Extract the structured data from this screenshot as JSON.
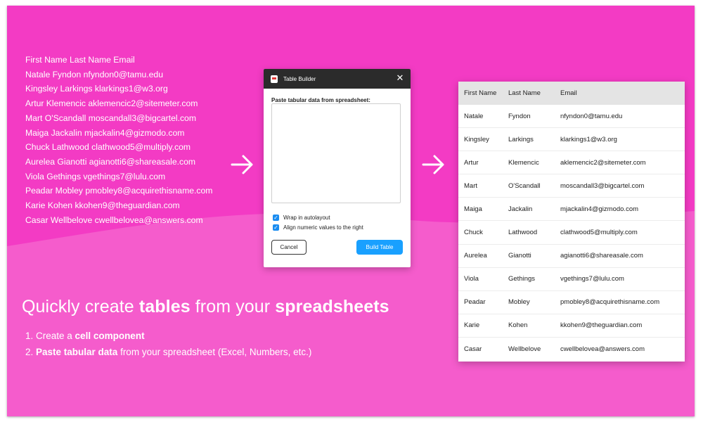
{
  "colors": {
    "background": "#f33bc4",
    "wave": "#f55ccc",
    "accent_button": "#19a0ff",
    "titlebar": "#2b2b2b"
  },
  "plain_text_lines": [
    "First Name Last Name Email",
    "Natale Fyndon nfyndon0@tamu.edu",
    "Kingsley Larkings klarkings1@w3.org",
    "Artur Klemencic aklemencic2@sitemeter.com",
    "Mart O'Scandall moscandall3@bigcartel.com",
    "Maiga Jackalin mjackalin4@gizmodo.com",
    "Chuck Lathwood clathwood5@multiply.com",
    "Aurelea Gianotti agianotti6@shareasale.com",
    "Viola Gethings vgethings7@lulu.com",
    "Peadar Mobley pmobley8@acquirethisname.com",
    "Karie Kohen kkohen9@theguardian.com",
    "Casar Wellbelove cwellbelovea@answers.com"
  ],
  "dialog": {
    "title": "Table Builder",
    "icon": "table-builder-app-icon",
    "close_icon": "close-icon",
    "paste_label": "Paste tabular data from spreadsheet:",
    "paste_value": "",
    "option_wrap": "Wrap in autolayout",
    "option_wrap_checked": true,
    "option_align": "Align numeric values to the right",
    "option_align_checked": true,
    "cancel_label": "Cancel",
    "build_label": "Build Table"
  },
  "arrows": [
    "arrow-right-icon",
    "arrow-right-icon"
  ],
  "heading": {
    "part1": "Quickly create ",
    "bold1": "tables",
    "part2": " from your ",
    "bold2": "spreadsheets"
  },
  "steps": [
    {
      "num": "1. ",
      "plain_before": "Create a ",
      "bold": "cell component",
      "plain_after": ""
    },
    {
      "num": "2. ",
      "plain_before": "",
      "bold": "Paste tabular data",
      "plain_after": " from your spreadsheet (Excel, Numbers, etc.)"
    }
  ],
  "table": {
    "headers": [
      "First Name",
      "Last Name",
      "Email"
    ],
    "rows": [
      [
        "Natale",
        "Fyndon",
        "nfyndon0@tamu.edu"
      ],
      [
        "Kingsley",
        "Larkings",
        "klarkings1@w3.org"
      ],
      [
        "Artur",
        "Klemencic",
        "aklemencic2@sitemeter.com"
      ],
      [
        "Mart",
        "O'Scandall",
        "moscandall3@bigcartel.com"
      ],
      [
        "Maiga",
        "Jackalin",
        "mjackalin4@gizmodo.com"
      ],
      [
        "Chuck",
        "Lathwood",
        "clathwood5@multiply.com"
      ],
      [
        "Aurelea",
        "Gianotti",
        "agianotti6@shareasale.com"
      ],
      [
        "Viola",
        "Gethings",
        "vgethings7@lulu.com"
      ],
      [
        "Peadar",
        "Mobley",
        "pmobley8@acquirethisname.com"
      ],
      [
        "Karie",
        "Kohen",
        "kkohen9@theguardian.com"
      ],
      [
        "Casar",
        "Wellbelove",
        "cwellbelovea@answers.com"
      ]
    ]
  }
}
